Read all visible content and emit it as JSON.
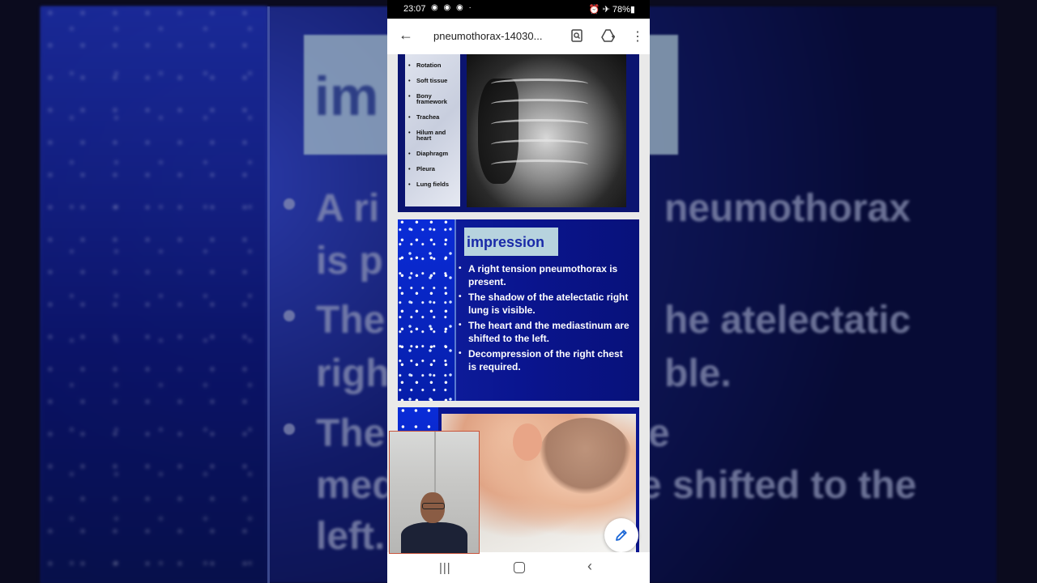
{
  "status_bar": {
    "time": "23:07",
    "left_icons": "◉ ◉ ◉ ·",
    "right": "⏰ ✈ 78%▮"
  },
  "app_bar": {
    "title": "pneumothorax-14030...",
    "back_icon": "←",
    "menu_icon": "⋮"
  },
  "slide1": {
    "checklist": [
      "Rotation",
      "Soft tissue",
      "Bony framework",
      "Trachea",
      "Hilum and heart",
      "Diaphragm",
      "Pleura",
      "Lung fields"
    ]
  },
  "slide2": {
    "title": "impression",
    "bullets": [
      "A right tension pneumothorax is present.",
      "The shadow of the atelectatic right lung is visible.",
      "The heart and the mediastinum are shifted to the left.",
      "Decompression of the right chest is required."
    ]
  },
  "background": {
    "title": "im",
    "line1": "A ri",
    "line1b": "neumothorax",
    "line2": "is p",
    "line3": "The",
    "line3b": "he atelectatic",
    "line4": "righ",
    "line4b": "ble.",
    "line5": "The",
    "line5b": "e",
    "line6": "med",
    "line6b": "e shifted to the",
    "line7": "left."
  },
  "nav_bar": {
    "recent_icon": "|||",
    "back_icon": "‹"
  },
  "colors": {
    "slide_blue": "#0a1590",
    "impression_box": "#b7d3de",
    "impression_text": "#1a2aa8"
  }
}
